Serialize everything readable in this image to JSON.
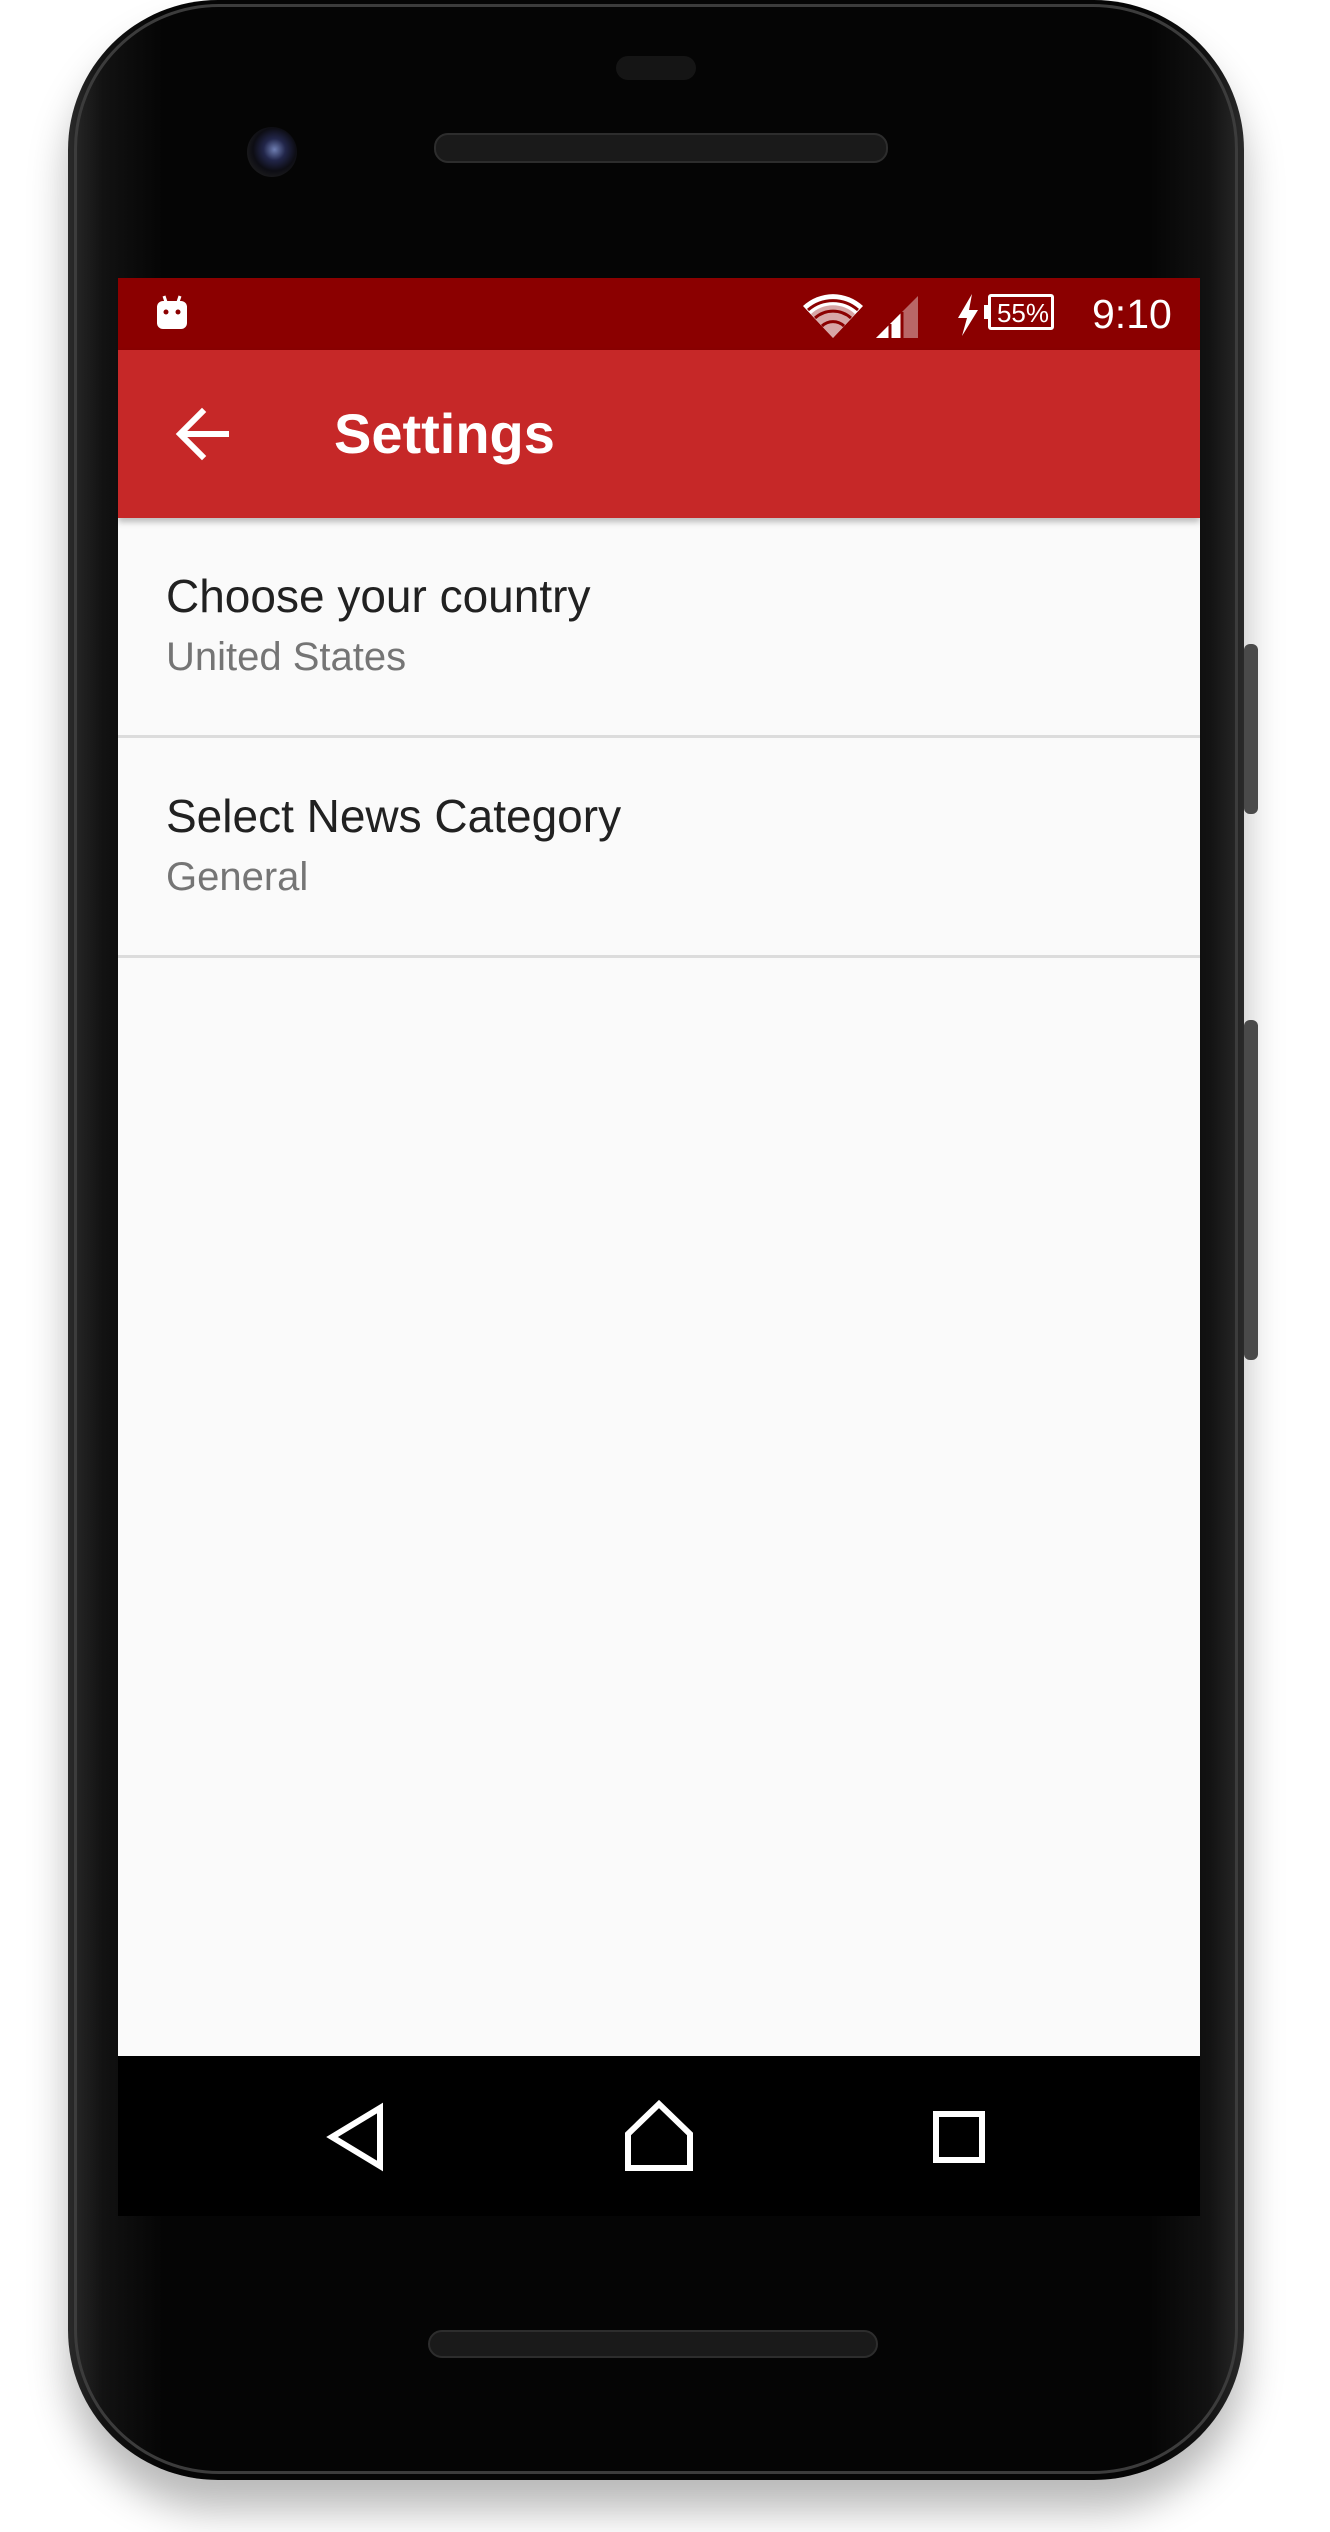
{
  "status_bar": {
    "time": "9:10",
    "battery_percent": "55%",
    "icons": [
      "android-icon",
      "wifi-icon",
      "signal-icon",
      "charging-bolt-icon",
      "battery-icon"
    ],
    "background_color": "#8b0000"
  },
  "app_bar": {
    "title": "Settings",
    "back_icon": "arrow-left-icon",
    "background_color": "#c62828"
  },
  "preferences": [
    {
      "title": "Choose your country",
      "summary": "United States"
    },
    {
      "title": "Select News Category",
      "summary": "General"
    }
  ],
  "nav_bar": {
    "icons": [
      "back-triangle-icon",
      "home-icon",
      "recents-icon"
    ]
  }
}
